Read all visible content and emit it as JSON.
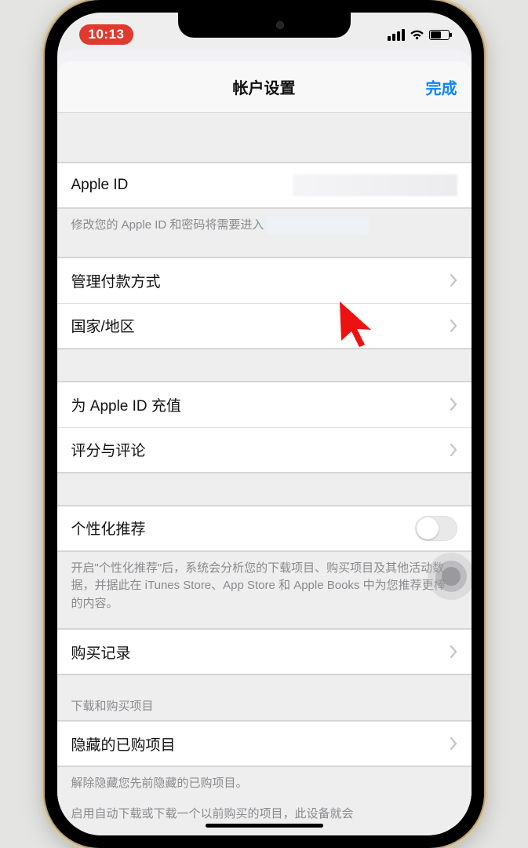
{
  "status": {
    "time": "10:13"
  },
  "sheet": {
    "title": "帐户设置",
    "done": "完成"
  },
  "appleId": {
    "label": "Apple ID",
    "value": "",
    "footer_prefix": "修改您的 Apple ID 和密码将需要进入"
  },
  "group2": {
    "payment": "管理付款方式",
    "region": "国家/地区"
  },
  "group3": {
    "topup": "为 Apple ID 充值",
    "ratings": "评分与评论"
  },
  "personalize": {
    "label": "个性化推荐",
    "footer": "开启\"个性化推荐\"后，系统会分析您的下载项目、购买项目及其他活动数据，并据此在 iTunes Store、App Store 和 Apple Books 中为您推荐更棒的内容。"
  },
  "purchaseHistory": {
    "label": "购买记录"
  },
  "hidden": {
    "section_header": "下载和购买项目",
    "label": "隐藏的已购项目",
    "footer": "解除隐藏您先前隐藏的已购项目。"
  },
  "autoDownload": {
    "footer_partial": "启用自动下载或下载一个以前购买的项目，此设备就会"
  }
}
